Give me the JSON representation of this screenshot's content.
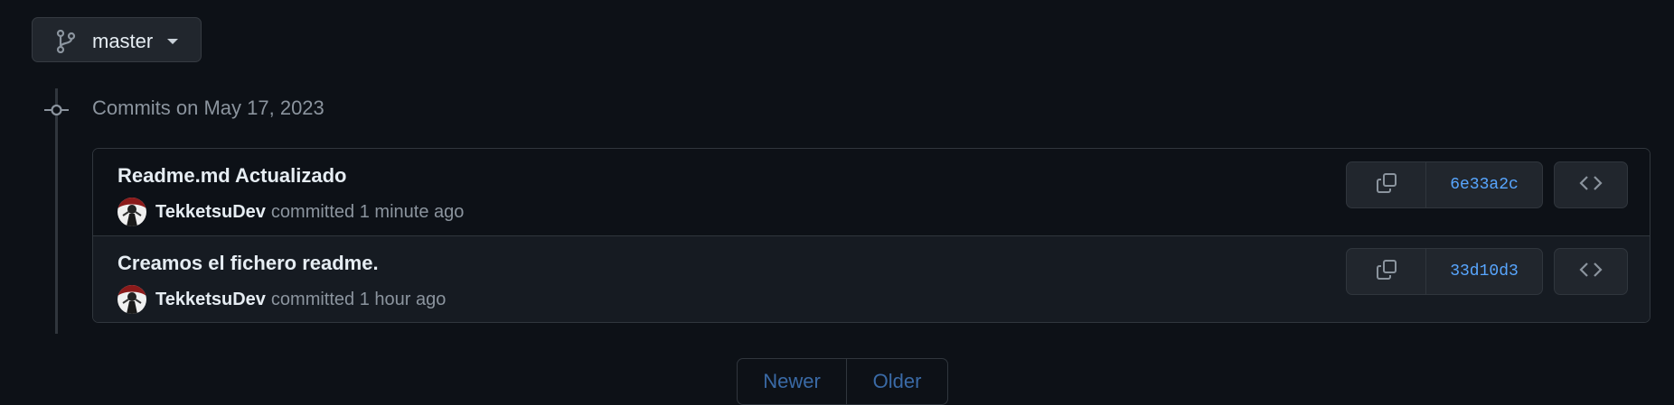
{
  "branch": {
    "name": "master",
    "icon": "git-branch-icon"
  },
  "timeline": {
    "heading": "Commits on May 17, 2023"
  },
  "commits": [
    {
      "title": "Readme.md Actualizado",
      "author": "TekketsuDev",
      "action": "committed",
      "time": "1 minute ago",
      "sha": "6e33a2c"
    },
    {
      "title": "Creamos el fichero readme.",
      "author": "TekketsuDev",
      "action": "committed",
      "time": "1 hour ago",
      "sha": "33d10d3"
    }
  ],
  "pagination": {
    "newer_label": "Newer",
    "older_label": "Older"
  },
  "colors": {
    "background": "#0d1117",
    "link": "#58a6ff",
    "muted": "#8b949e",
    "border": "#30363d"
  }
}
